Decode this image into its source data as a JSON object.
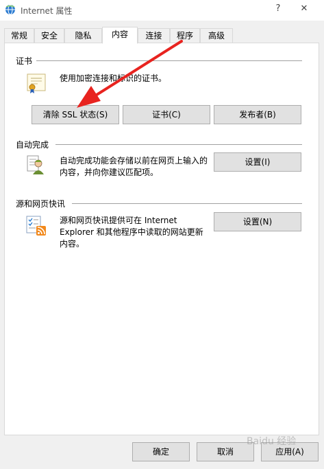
{
  "window": {
    "title": "Internet 属性",
    "help": "?",
    "close": "✕"
  },
  "tabs": [
    "常规",
    "安全",
    "隐私",
    "内容",
    "连接",
    "程序",
    "高级"
  ],
  "active_tab": "内容",
  "certificates": {
    "group_label": "证书",
    "description": "使用加密连接和标识的证书。",
    "clear_ssl_button": "清除 SSL 状态(S)",
    "certificates_button": "证书(C)",
    "publishers_button": "发布者(B)"
  },
  "autocomplete": {
    "group_label": "自动完成",
    "description_line1": "自动完成功能会存储以前在网页上输入的",
    "description_line2": "内容，并向你建议匹配项。",
    "settings_button": "设置(I)"
  },
  "feeds": {
    "group_label": "源和网页快讯",
    "description_line1": "源和网页快讯提供可在 Internet",
    "description_line2": "Explorer 和其他程序中读取的网站更新",
    "description_line3": "内容。",
    "settings_button": "设置(N)"
  },
  "footer": {
    "ok_button": "确定",
    "cancel_button": "取消",
    "apply_button": "应用(A)"
  },
  "watermark": "Baidu 经验",
  "colors": {
    "arrow": "#e8231f",
    "button_face": "#e1e1e1",
    "button_border": "#adadad"
  },
  "icons": {
    "app": "ie-globe-icon",
    "certificate": "certificate-icon",
    "autocomplete": "autocomplete-user-icon",
    "feeds": "rss-feed-icon"
  }
}
